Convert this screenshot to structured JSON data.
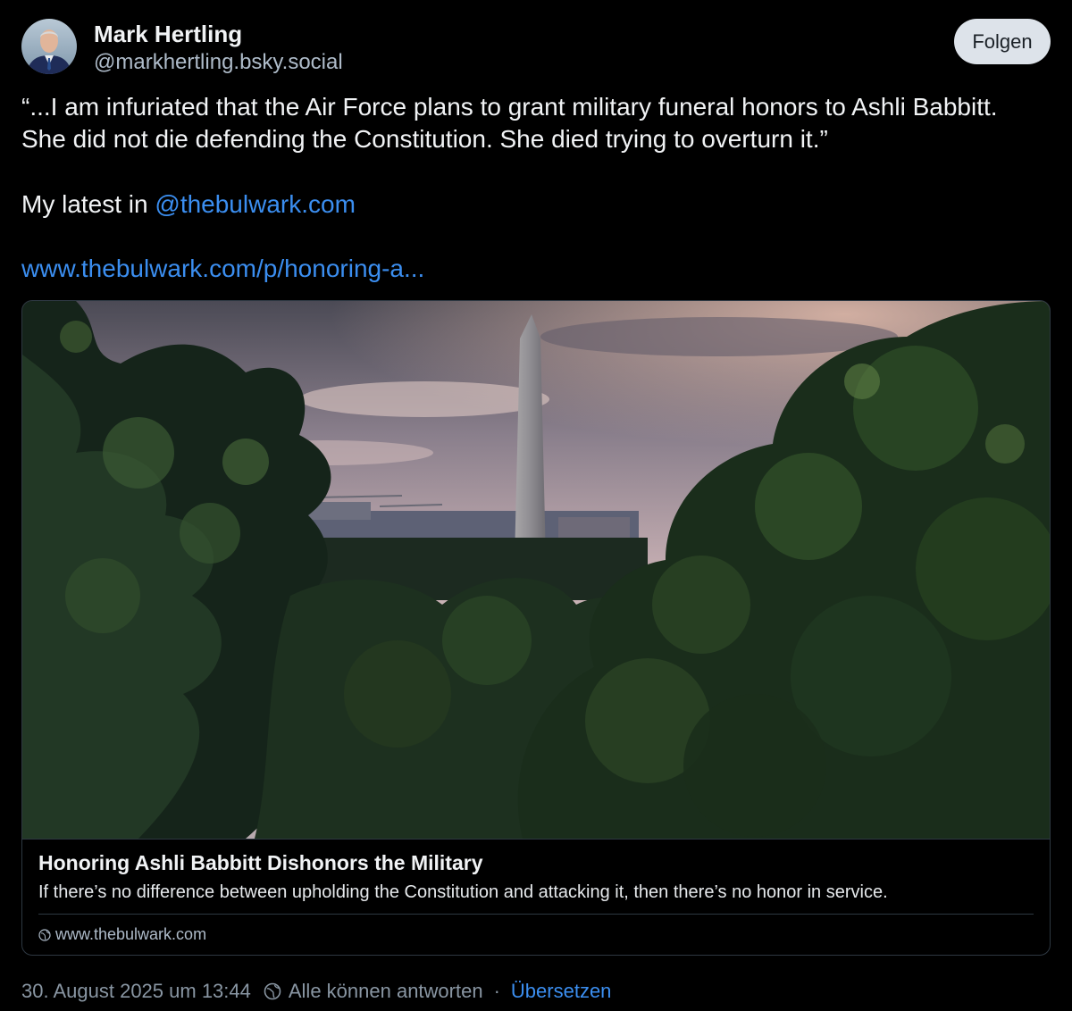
{
  "author": {
    "name": "Mark Hertling",
    "handle": "@markhertling.bsky.social",
    "avatar_icon": "user-avatar"
  },
  "follow_button": {
    "label": "Folgen"
  },
  "post": {
    "line1": "“...I am infuriated that the Air Force plans to grant military funeral honors to Ashli Babbitt. She did not die defending the Constitution. She died trying to overturn it.”",
    "latest_prefix": "My latest in ",
    "mention": "@thebulwark.com",
    "link": "www.thebulwark.com/p/honoring-a..."
  },
  "link_card": {
    "image_icon": "washington-monument-photo",
    "title": "Honoring Ashli Babbitt Dishonors the Military",
    "description": "If there’s no difference between upholding the Constitution and attacking it, then there’s no honor in service.",
    "domain": "www.thebulwark.com",
    "domain_icon": "globe-icon"
  },
  "meta": {
    "timestamp": "30. August 2025 um 13:44",
    "reply_setting": "Alle können antworten",
    "separator": "·",
    "translate": "Übersetzen",
    "reply_icon": "globe-icon"
  },
  "colors": {
    "background": "#000000",
    "link": "#3b8ef0",
    "muted": "#8996a3",
    "follow_button_bg": "#dde3ea"
  }
}
